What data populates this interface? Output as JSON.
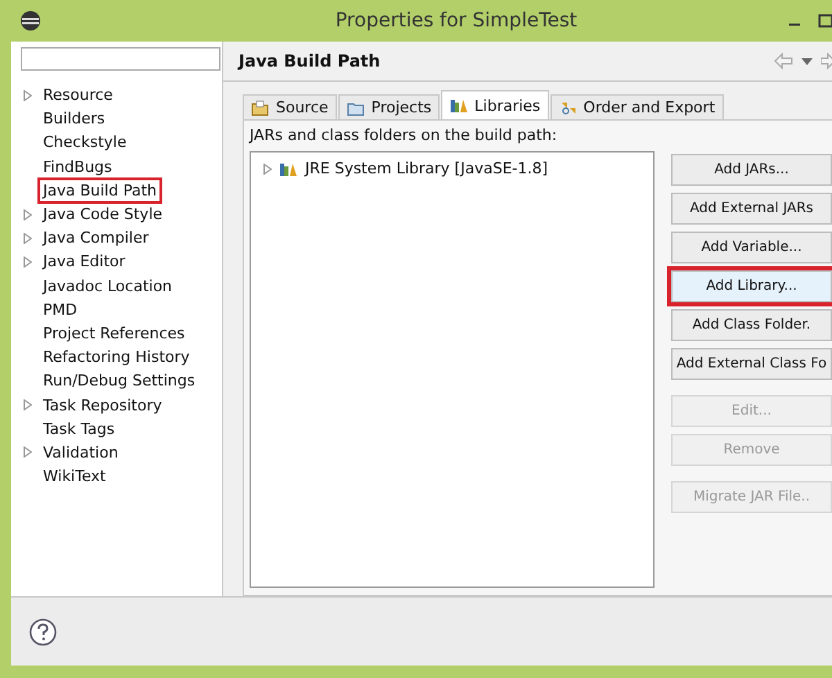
{
  "window": {
    "title": "Properties for SimpleTest"
  },
  "sidebar": {
    "items": [
      {
        "label": "Resource",
        "expandable": true,
        "highlighted": false
      },
      {
        "label": "Builders",
        "expandable": false,
        "highlighted": false
      },
      {
        "label": "Checkstyle",
        "expandable": false,
        "highlighted": false
      },
      {
        "label": "FindBugs",
        "expandable": false,
        "highlighted": false
      },
      {
        "label": "Java Build Path",
        "expandable": false,
        "highlighted": true
      },
      {
        "label": "Java Code Style",
        "expandable": true,
        "highlighted": false
      },
      {
        "label": "Java Compiler",
        "expandable": true,
        "highlighted": false
      },
      {
        "label": "Java Editor",
        "expandable": true,
        "highlighted": false
      },
      {
        "label": "Javadoc Location",
        "expandable": false,
        "highlighted": false
      },
      {
        "label": "PMD",
        "expandable": false,
        "highlighted": false
      },
      {
        "label": "Project References",
        "expandable": false,
        "highlighted": false
      },
      {
        "label": "Refactoring History",
        "expandable": false,
        "highlighted": false
      },
      {
        "label": "Run/Debug Settings",
        "expandable": false,
        "highlighted": false
      },
      {
        "label": "Task Repository",
        "expandable": true,
        "highlighted": false
      },
      {
        "label": "Task Tags",
        "expandable": false,
        "highlighted": false
      },
      {
        "label": "Validation",
        "expandable": true,
        "highlighted": false
      },
      {
        "label": "WikiText",
        "expandable": false,
        "highlighted": false
      }
    ]
  },
  "page": {
    "title": "Java Build Path"
  },
  "tabs": [
    {
      "label": "Source",
      "kind": "source",
      "selected": false
    },
    {
      "label": "Projects",
      "kind": "projects",
      "selected": false
    },
    {
      "label": "Libraries",
      "kind": "libraries",
      "selected": true
    },
    {
      "label": "Order and Export",
      "kind": "order",
      "selected": false
    }
  ],
  "list_label": "JARs and class folders on the build path:",
  "libraries": [
    {
      "label": "JRE System Library [JavaSE-1.8]",
      "expanded": false
    }
  ],
  "button_groups": [
    [
      {
        "label": "Add JARs...",
        "disabled": false,
        "highlighted": false
      },
      {
        "label": "Add External JARs",
        "disabled": false,
        "highlighted": false
      },
      {
        "label": "Add Variable...",
        "disabled": false,
        "highlighted": false
      },
      {
        "label": "Add Library...",
        "disabled": false,
        "highlighted": true
      },
      {
        "label": "Add Class Folder.",
        "disabled": false,
        "highlighted": false
      },
      {
        "label": "Add External Class Fo",
        "disabled": false,
        "highlighted": false
      }
    ],
    [
      {
        "label": "Edit...",
        "disabled": true,
        "highlighted": false
      },
      {
        "label": "Remove",
        "disabled": true,
        "highlighted": false
      }
    ],
    [
      {
        "label": "Migrate JAR File..",
        "disabled": true,
        "highlighted": false
      }
    ]
  ]
}
